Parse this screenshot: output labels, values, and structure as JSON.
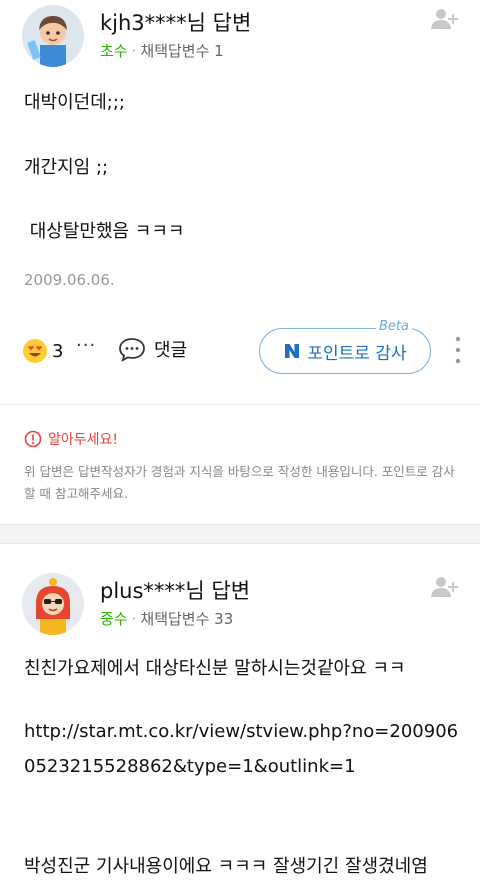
{
  "answers": [
    {
      "author": "kjh3****님 답변",
      "grade": "초수",
      "meta_separator": "·",
      "adopted_label": "채택답변수 1",
      "body_lines": [
        "대박이던데;;;",
        "개간지임 ;;",
        " 대상탈만했음 ㅋㅋㅋ"
      ],
      "date": "2009.06.06.",
      "reaction_count": "3",
      "more_label": "···",
      "comment_label": "댓글",
      "point_label": "포인트로 감사",
      "beta_label": "Beta"
    },
    {
      "author": "plus****님 답변",
      "grade": "중수",
      "meta_separator": "·",
      "adopted_label": "채택답변수 33",
      "body_lines": [
        "친친가요제에서 대상타신분 말하시는것같아요 ㅋㅋ",
        "http://star.mt.co.kr/view/stview.php?no=200906",
        "0523215528862&type=1&outlink=1",
        "박성진군 기사내용이에요 ㅋㅋㅋ 잘생기긴 잘생겼네염"
      ]
    }
  ],
  "notice": {
    "title": "알아두세요!",
    "text": "위 답변은 답변작성자가 경험과 지식을 바탕으로 작성한 내용입니다. 포인트로 감사할 때 참고해주세요."
  },
  "colors": {
    "grade_green": "#2db400",
    "point_blue": "#1e6fc4",
    "notice_red": "#e8423a"
  },
  "icons": [
    "profile-avatar",
    "add-friend-icon",
    "heart-eyes-emoji",
    "comment-bubble-icon",
    "naver-n-icon",
    "kebab-menu-icon",
    "alert-circle-icon"
  ]
}
